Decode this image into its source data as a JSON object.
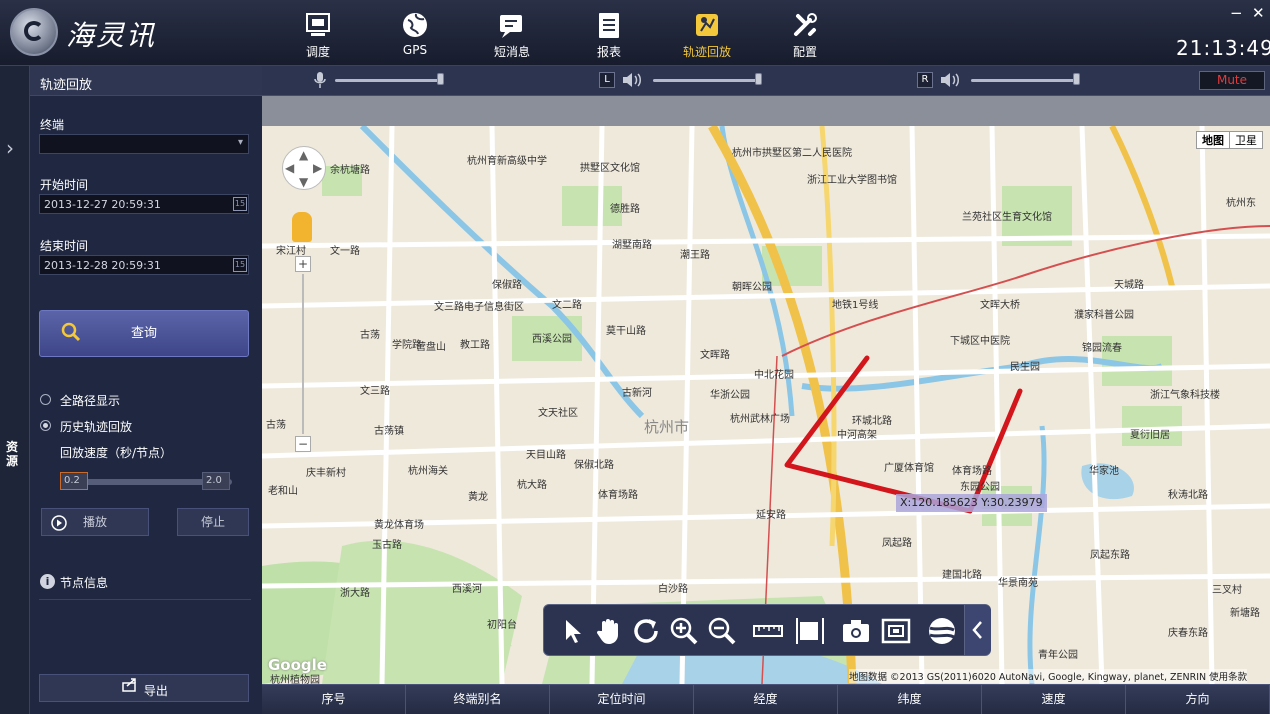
{
  "app": {
    "title": "海灵讯",
    "clock": "21:13:49",
    "win_min": "−",
    "win_close": "✕"
  },
  "nav": [
    {
      "label": "调度",
      "icon": "dispatch-screen-icon"
    },
    {
      "label": "GPS",
      "icon": "globe-icon"
    },
    {
      "label": "短消息",
      "icon": "message-icon"
    },
    {
      "label": "报表",
      "icon": "report-icon"
    },
    {
      "label": "轨迹回放",
      "icon": "track-playback-icon",
      "active": true
    },
    {
      "label": "配置",
      "icon": "tools-icon"
    }
  ],
  "sidebar": {
    "collapsed_label": "资源",
    "expand_icon": "›"
  },
  "panel": {
    "title": "轨迹回放",
    "terminal_label": "终端",
    "terminal_value": "",
    "start_label": "开始时间",
    "start_value": "2013-12-27 20:59:31",
    "end_label": "结束时间",
    "end_value": "2013-12-28 20:59:31",
    "calendar_glyph": "15",
    "query_label": "查询",
    "radio_all": "全路径显示",
    "radio_history": "历史轨迹回放",
    "speed_label": "回放速度（秒/节点）",
    "speed_min": "0.2",
    "speed_max": "2.0",
    "play_label": "播放",
    "stop_label": "停止",
    "node_info_label": "节点信息",
    "export_label": "导出"
  },
  "audio": {
    "left_channel": "L",
    "right_channel": "R",
    "mute_label": "Mute",
    "mic_level": 1.0,
    "left_level": 1.0,
    "right_level": 1.0
  },
  "map": {
    "type_map": "地图",
    "type_satellite": "卫星",
    "coord_text": "X:120.185623   Y:30.23979",
    "copyright": "地图数据 ©2013 GS(2011)6020 AutoNavi, Google, Kingway, planet, ZENRIN   使用条款",
    "google": "Google",
    "labels": [
      "余杭塘路",
      "杭州育新高级中学",
      "拱墅区文化馆",
      "杭州市拱墅区第二人民医院",
      "浙江工业大学图书馆",
      "兰苑社区生育文化馆",
      "杭州东",
      "德胜路",
      "湖墅南路",
      "潮王路",
      "朝晖公园",
      "地铁1号线",
      "文晖大桥",
      "天城路",
      "濮家科普公园",
      "锦园流春",
      "文三路电子信息街区",
      "西溪公园",
      "文二路",
      "文晖路",
      "中北花园",
      "下城区中医院",
      "民生园",
      "浙江气象科技楼",
      "华浙公园",
      "古新河",
      "杭州武林广场",
      "环城北路",
      "中河高架",
      "杭州市",
      "夏衍旧居",
      "文三路",
      "古荡",
      "古荡镇",
      "文天社区",
      "天目山路",
      "广厦体育馆",
      "体育场路",
      "东园公园",
      "华家池",
      "庆丰新村",
      "杭州海关",
      "黄龙",
      "杭大路",
      "体育场路",
      "凤起路",
      "凤起东路",
      "黄龙体育场",
      "浙大路",
      "西溪河",
      "白沙路",
      "延安路",
      "建国北路",
      "华景南苑",
      "初阳台",
      "保俶北路",
      "庆春东路",
      "青年公园",
      "秋涛北路",
      "三叉村",
      "杭州植物园",
      "老和山",
      "宋江村",
      "文一路",
      "古荡",
      "玉古路",
      "学院路",
      "保俶路",
      "莫干山路",
      "教工路",
      "营盘山",
      "新塘路"
    ]
  },
  "tools": [
    "pointer-icon",
    "hand-icon",
    "refresh-icon",
    "zoom-in-icon",
    "zoom-out-icon",
    "ruler-icon",
    "fit-icon",
    "camera-icon",
    "screenshot-icon",
    "globe-map-icon",
    "collapse-icon"
  ],
  "table": {
    "columns": [
      "序号",
      "终端别名",
      "定位时间",
      "经度",
      "纬度",
      "速度",
      "方向"
    ]
  }
}
